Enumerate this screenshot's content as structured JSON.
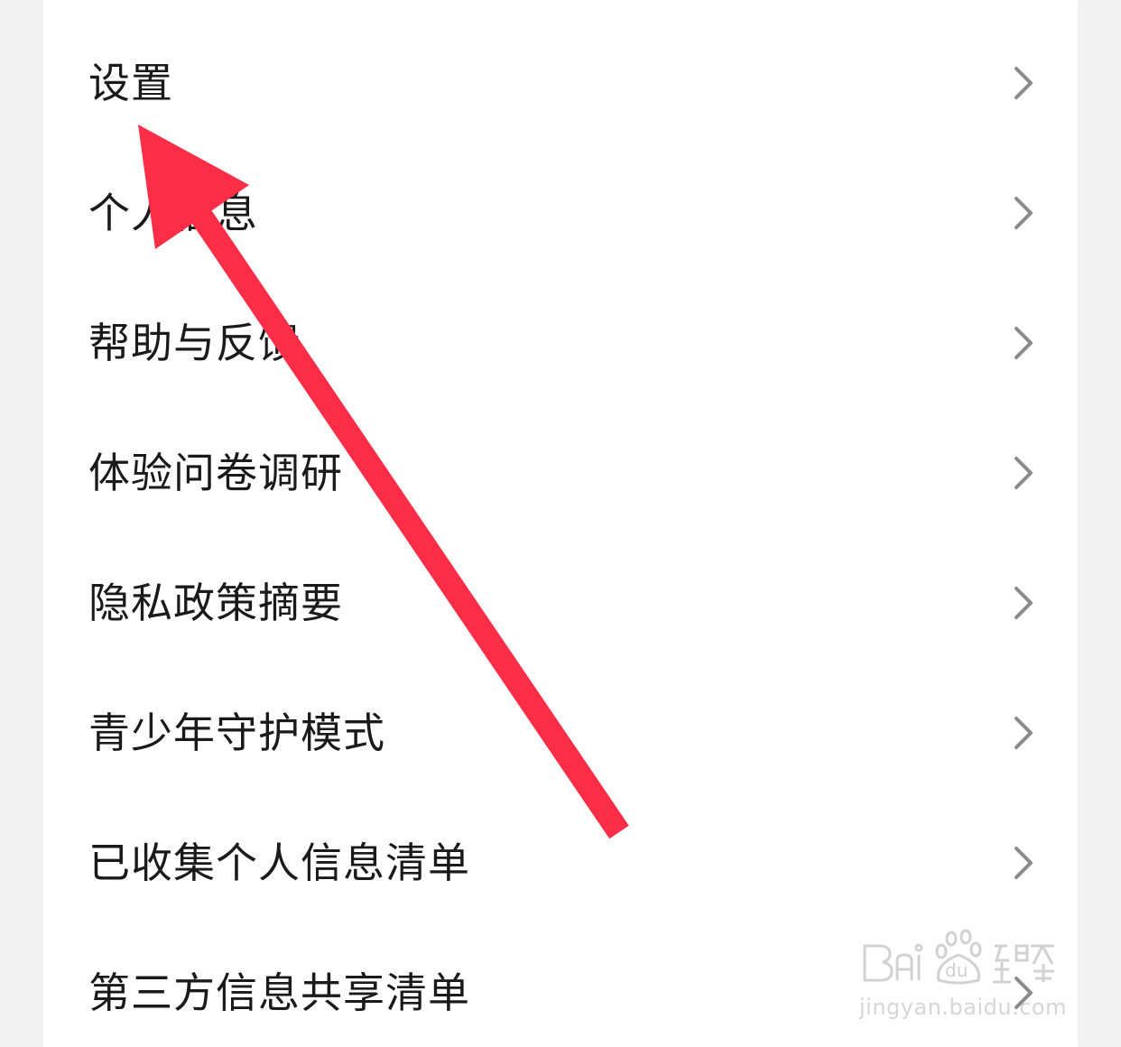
{
  "menu": {
    "items": [
      {
        "label": "设置",
        "icon": "chevron-right-icon"
      },
      {
        "label": "个人信息",
        "icon": "chevron-right-icon"
      },
      {
        "label": "帮助与反馈",
        "icon": "chevron-right-icon"
      },
      {
        "label": "体验问卷调研",
        "icon": "chevron-right-icon"
      },
      {
        "label": "隐私政策摘要",
        "icon": "chevron-right-icon"
      },
      {
        "label": "青少年守护模式",
        "icon": "chevron-right-icon"
      },
      {
        "label": "已收集个人信息清单",
        "icon": "chevron-right-icon"
      },
      {
        "label": "第三方信息共享清单",
        "icon": "chevron-right-icon"
      }
    ]
  },
  "annotation": {
    "arrow_color": "#fc2d46",
    "target": "设置"
  },
  "watermark": {
    "brand": "Baidu经验",
    "url": "jingyan.baidu.com"
  },
  "colors": {
    "background": "#f2f2f2",
    "card": "#ffffff",
    "text": "#1a1a1a",
    "chevron": "#8a8a8a"
  }
}
